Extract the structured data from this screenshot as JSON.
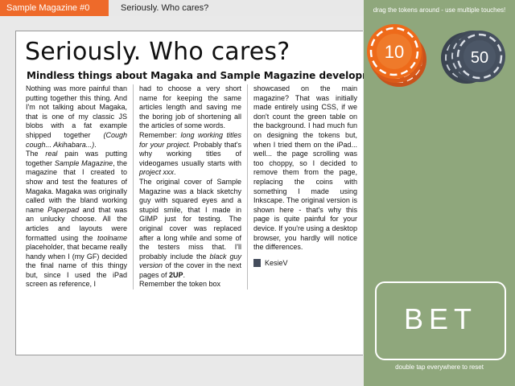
{
  "header": {
    "magazine_tab": "Sample Magazine #0",
    "breadcrumb": "Seriously. Who cares?"
  },
  "article": {
    "title": "Seriously. Who cares?",
    "subtitle": "Mindless things about Magaka and Sample Magazine development.",
    "author": "KesieV"
  },
  "panel": {
    "hint": "drag the tokens around - use multiple touches!",
    "bet_label": "BET",
    "reset_hint": "double tap everywhere to reset"
  },
  "tokens": [
    {
      "label": "10",
      "color": "#ee6a1a"
    },
    {
      "label": "50",
      "color": "#454f5e"
    }
  ],
  "colors": {
    "accent": "#ee6a2a",
    "panel": "#8fa77c",
    "author_mark": "#444c5c"
  }
}
